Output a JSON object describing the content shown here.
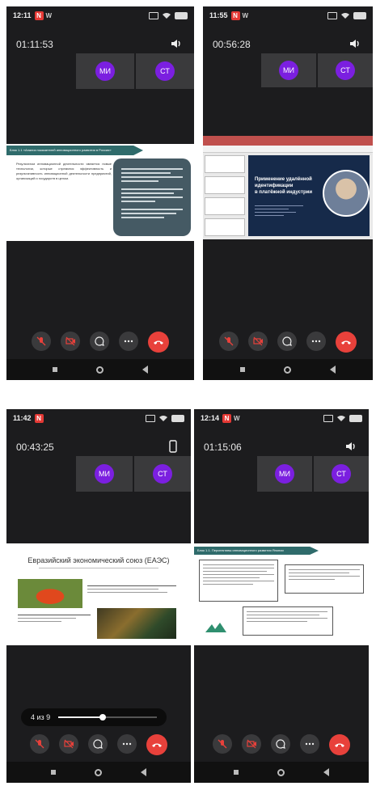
{
  "panels": [
    {
      "status_time": "12:11",
      "status_app": "W",
      "call_timer": "01:11:53",
      "participants": [
        "МИ",
        "СТ"
      ],
      "slide": {
        "header": "Блок 1.1 «Анализ показателей инновационного развития в России»",
        "text": "Результатом инновационной деятельности является новые технологии, которые стремятся эффективность и результативность инновационной деятельности предприятий, организаций и государств в целом."
      }
    },
    {
      "status_time": "11:55",
      "status_app": "W",
      "call_timer": "00:56:28",
      "participants": [
        "МИ",
        "СТ"
      ],
      "slide": {
        "title_line1": "Применение удалённой",
        "title_line2": "идентификации",
        "title_line3": "в платёжной индустрии"
      }
    },
    {
      "status_time": "11:42",
      "status_app": "",
      "call_timer": "00:43:25",
      "participants": [
        "МИ",
        "СТ"
      ],
      "slide": {
        "title": "Евразийский экономический союз (ЕАЭС)"
      },
      "pager": {
        "label": "4 из 9",
        "progress": 0.45
      }
    },
    {
      "status_time": "12:14",
      "status_app": "W",
      "call_timer": "01:15:06",
      "participants": [
        "МИ",
        "СТ"
      ],
      "slide": {
        "header": "Блок 1.1. Перспективы инновационного развития Японии"
      }
    }
  ]
}
